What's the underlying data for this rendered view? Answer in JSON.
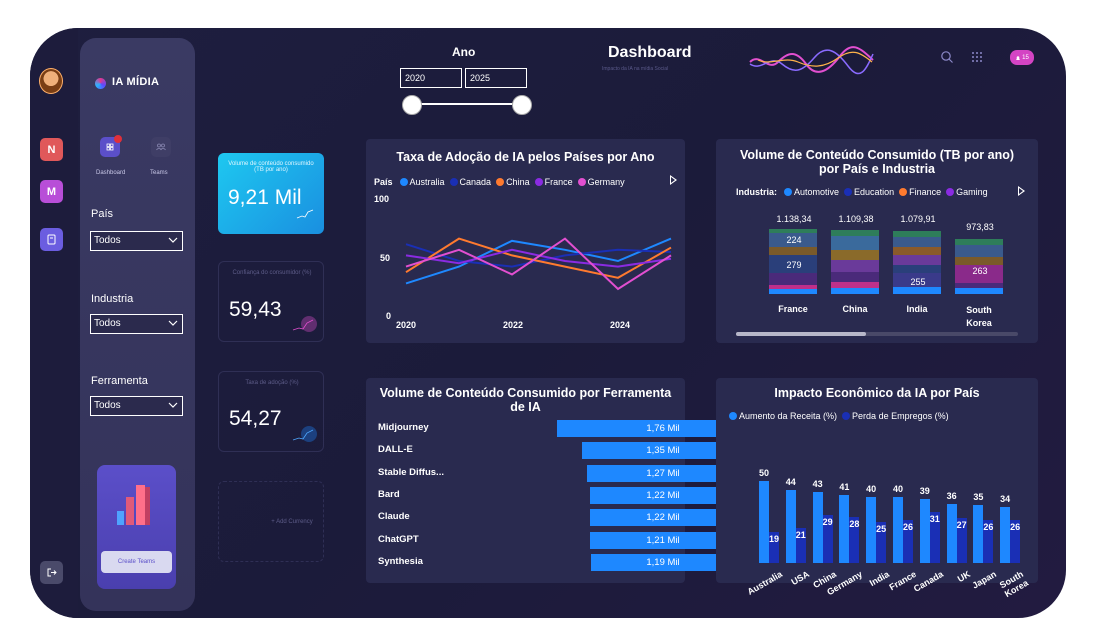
{
  "header": {
    "title": "Dashboard",
    "subtitle": "Impacto da IA na mídia Social",
    "notification_count": "15"
  },
  "year_filter": {
    "label": "Ano",
    "from": "2020",
    "to": "2025"
  },
  "rail": {
    "items": [
      {
        "label": "N",
        "color": "#e0585a"
      },
      {
        "label": "M",
        "color": "#b84ed8"
      },
      {
        "label": "",
        "color": "#6b5de0"
      }
    ]
  },
  "sidebar": {
    "brand": "IA MÍDIA",
    "nav": [
      {
        "label": "Dashboard"
      },
      {
        "label": "Teams"
      }
    ],
    "filters": [
      {
        "label": "País",
        "value": "Todos"
      },
      {
        "label": "Industria",
        "value": "Todos"
      },
      {
        "label": "Ferramenta",
        "value": "Todos"
      }
    ],
    "promo_button": "Create Teams"
  },
  "kpis": [
    {
      "label": "Volume de conteúdo consumido (TB por ano)",
      "value": "9,21 Mil"
    },
    {
      "label": "Confiança do consumidor (%)",
      "value": "59,43"
    },
    {
      "label": "Taxa de adoção (%)",
      "value": "54,27"
    },
    {
      "label": "+ Add Currency",
      "value": ""
    }
  ],
  "colors": {
    "accent_blue": "#1e88ff",
    "dark_blue": "#1a2fb5",
    "orange": "#ff7a2f",
    "purple": "#8a2be2",
    "pink": "#e24fd0"
  },
  "chart_data": [
    {
      "type": "line",
      "title": "Taxa de Adoção de IA pelos Países por Ano",
      "legend_title": "País",
      "x": [
        2020,
        2021,
        2022,
        2023,
        2024,
        2025
      ],
      "x_ticks": [
        "2020",
        "2022",
        "2024"
      ],
      "ylim": [
        0,
        100
      ],
      "y_ticks": [
        "0",
        "50",
        "100"
      ],
      "series": [
        {
          "name": "Australia",
          "color": "#1e88ff",
          "values": [
            30,
            45,
            68,
            60,
            50,
            70
          ]
        },
        {
          "name": "Canada",
          "color": "#1a2fb5",
          "values": [
            65,
            50,
            45,
            55,
            60,
            58
          ]
        },
        {
          "name": "China",
          "color": "#ff7a2f",
          "values": [
            40,
            70,
            55,
            45,
            35,
            62
          ]
        },
        {
          "name": "France",
          "color": "#8a2be2",
          "values": [
            55,
            48,
            60,
            50,
            45,
            52
          ]
        },
        {
          "name": "Germany",
          "color": "#e24fd0",
          "values": [
            45,
            60,
            38,
            70,
            25,
            55
          ]
        }
      ]
    },
    {
      "type": "bar",
      "stacked": true,
      "title": "Volume de Conteúdo Consumido (TB por ano) por País e Industria",
      "legend_title": "Industria:",
      "legend": [
        {
          "name": "Automotive",
          "color": "#1e88ff"
        },
        {
          "name": "Education",
          "color": "#1a2fb5"
        },
        {
          "name": "Finance",
          "color": "#ff7a2f"
        },
        {
          "name": "Gaming",
          "color": "#8a2be2"
        }
      ],
      "categories": [
        "France",
        "China",
        "India",
        "South Korea"
      ],
      "totals": [
        "1.138,34",
        "1.109,38",
        "1.079,91",
        "973,83"
      ],
      "segment_labels": [
        [
          "224",
          "279"
        ],
        [],
        [
          "255"
        ],
        [
          "263"
        ]
      ]
    },
    {
      "type": "bar",
      "orientation": "horizontal",
      "title": "Volume de Conteúdo Consumido por Ferramenta de IA",
      "categories": [
        "Midjourney",
        "DALL-E",
        "Stable Diffus...",
        "Bard",
        "Claude",
        "ChatGPT",
        "Synthesia"
      ],
      "values": [
        1.76,
        1.35,
        1.27,
        1.22,
        1.22,
        1.21,
        1.19
      ],
      "labels": [
        "1,76 Mil",
        "1,35 Mil",
        "1,27 Mil",
        "1,22 Mil",
        "1,22 Mil",
        "1,21 Mil",
        "1,19 Mil"
      ]
    },
    {
      "type": "bar",
      "title": "Impacto Econômico da IA por País",
      "categories": [
        "Australia",
        "USA",
        "China",
        "Germany",
        "India",
        "France",
        "Canada",
        "UK",
        "Japan",
        "South Korea"
      ],
      "series": [
        {
          "name": "Aumento da Receita (%)",
          "color": "#1e88ff",
          "values": [
            50,
            44,
            43,
            41,
            40,
            40,
            39,
            36,
            35,
            34
          ]
        },
        {
          "name": "Perda de Empregos (%)",
          "color": "#1a2fb5",
          "values": [
            19,
            21,
            29,
            28,
            25,
            26,
            31,
            27,
            26,
            26
          ]
        }
      ]
    }
  ]
}
